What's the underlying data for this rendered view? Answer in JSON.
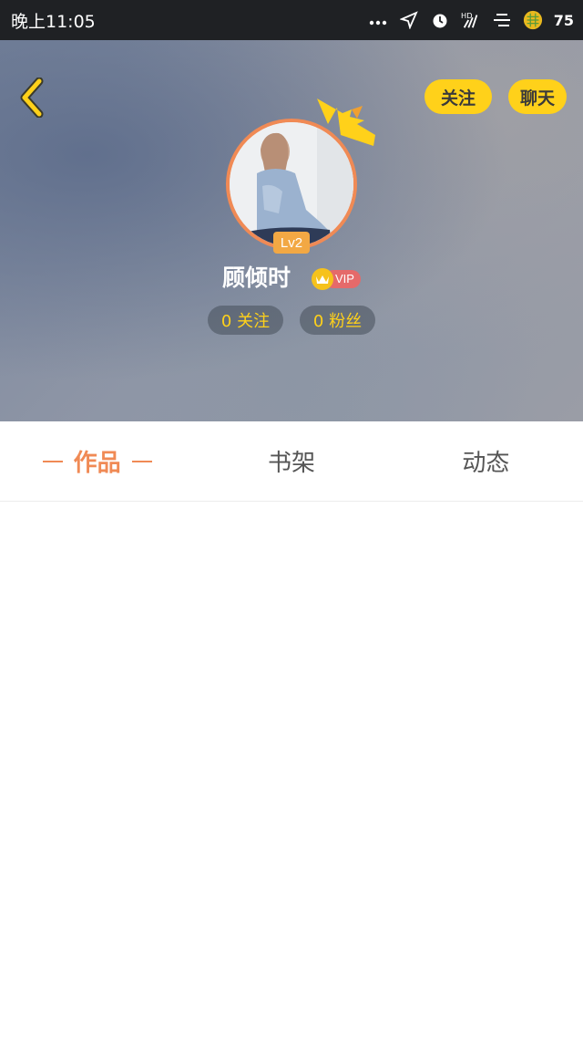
{
  "status_bar": {
    "time": "晚上11:05",
    "battery": "75",
    "icons": [
      "more-dots-icon",
      "location-icon",
      "alarm-icon",
      "hd-signal-icon",
      "menu-icon",
      "app-icon"
    ]
  },
  "header": {
    "follow_label": "关注",
    "chat_label": "聊天",
    "level": "Lv2",
    "username": "顾倾时",
    "vip_label": "VIP",
    "following": "0 关注",
    "fans": "0 粉丝"
  },
  "tabs": [
    {
      "label": "作品",
      "active": true
    },
    {
      "label": "书架",
      "active": false
    },
    {
      "label": "动态",
      "active": false
    }
  ],
  "colors": {
    "accent": "#f08a55",
    "button_yellow": "#ffd11a",
    "status_bg": "#1f2124"
  }
}
